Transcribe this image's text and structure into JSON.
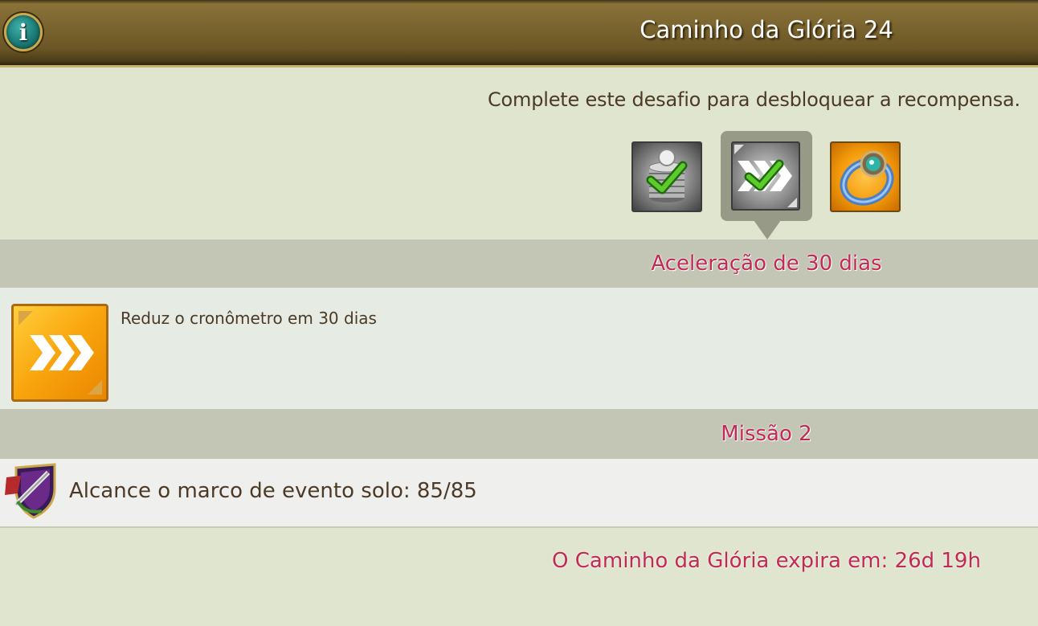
{
  "header": {
    "info_icon": "i",
    "title": "Caminho da Glória 24"
  },
  "challenge": {
    "subtitle": "Complete este desafio para desbloquear a recompensa.",
    "rewards": [
      {
        "icon": "coins-check-icon",
        "state": "completed"
      },
      {
        "icon": "speedup-check-icon",
        "state": "completed-selected"
      },
      {
        "icon": "ring-icon",
        "state": "locked"
      }
    ]
  },
  "reward_detail": {
    "heading": "Aceleração de 30 dias",
    "icon": "speedup-icon",
    "description": "Reduz o cronômetro em 30 dias"
  },
  "mission": {
    "heading": "Missão 2",
    "icon": "solo-event-shield-icon",
    "text": "Alcance o marco de evento solo: 85/85"
  },
  "footer": {
    "expire_text": "O Caminho da Glória expira em: 26d 19h"
  },
  "colors": {
    "accent": "#c22a55",
    "text": "#4b3a25",
    "background": "#e0e5cf"
  }
}
